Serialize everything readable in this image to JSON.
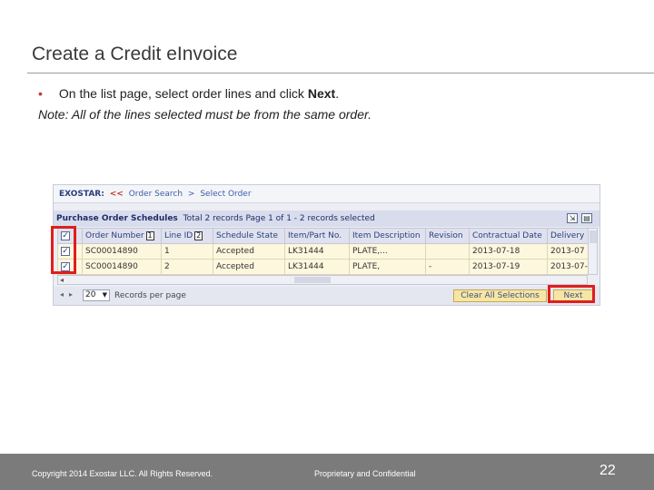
{
  "slide": {
    "title": "Create a Credit eInvoice",
    "bullet_pre": "On the list page, select order lines and click ",
    "bullet_bold": "Next",
    "bullet_post": ".",
    "note": "Note:  All of the lines selected must be from the same order."
  },
  "app": {
    "brand": "EXOSTAR:",
    "back_arrows": "<<",
    "crumb_order_search": "Order Search",
    "crumb_sep": ">",
    "crumb_select_order": "Select Order",
    "section_title": "Purchase Order Schedules",
    "section_info": "Total 2 records Page 1 of 1 - 2 records selected",
    "columns": [
      "Order Number",
      "Line ID",
      "Schedule State",
      "Item/Part No.",
      "Item Description",
      "Revision",
      "Contractual Date",
      "Delivery"
    ],
    "sort_badges": [
      "1",
      "2"
    ],
    "rows": [
      {
        "checked": "✓",
        "order": "SC00014890",
        "line": "1",
        "state": "Accepted",
        "part": "LK31444",
        "desc": "PLATE,...",
        "rev": "",
        "date": "2013-07-18",
        "delivery": "2013-07"
      },
      {
        "checked": "✓",
        "order": "SC00014890",
        "line": "2",
        "state": "Accepted",
        "part": "LK31444",
        "desc": "PLATE,",
        "rev": "-",
        "date": "2013-07-19",
        "delivery": "2013-07-"
      }
    ],
    "page_size": "20",
    "per_page_label": "Records per page",
    "clear_button": "Clear All Selections",
    "next_button": "Next"
  },
  "footer": {
    "copyright": "Copyright 2014 Exostar LLC. All Rights Reserved.",
    "proprietary": "Proprietary and Confidential",
    "page_number": "22"
  },
  "colors": {
    "highlight": "#e11d1d",
    "footer_bg": "#7b7b7b",
    "row_bg": "#fdf7de",
    "button_bg": "#f7e6a3"
  }
}
